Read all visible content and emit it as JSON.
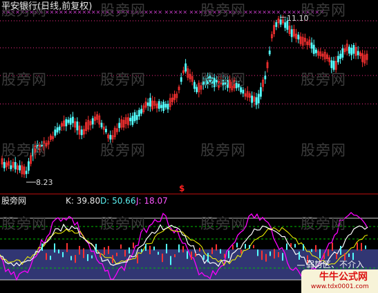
{
  "main_panel": {
    "title": "平安银行(日线,前复权)",
    "high_label": "11.10",
    "low_label": "8.23",
    "dollar_marker": "$"
  },
  "indicator_panel": {
    "name": "股旁网",
    "k_label": "K: 39.80",
    "d_label": "D: 50.66",
    "j_label": "J: 18.07",
    "zone_label": "弱势区、不介入"
  },
  "watermark": "股旁网",
  "logo_text": "牛牛公式网",
  "logo_url": "www.tdx0001.com",
  "colors": {
    "background": "#000000",
    "bull_candle": "#ff3232",
    "bear_candle": "#54ffff",
    "dotted_line": "#ff2d8c",
    "k_line": "#ffffff",
    "d_line": "#ffff00",
    "j_line": "#ff00ff",
    "zone_fill": "#3a3f87",
    "green_dashed": "#00c000"
  }
}
